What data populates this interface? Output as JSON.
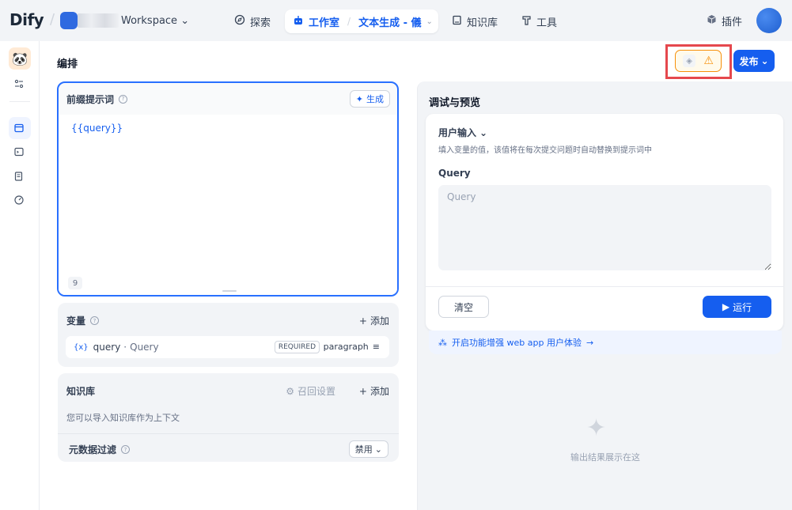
{
  "nav": {
    "logo": "Dify",
    "workspace_label": "Workspace",
    "explore": "探索",
    "studio": "工作室",
    "app_name": "文本生成 - 儀",
    "knowledge": "知识库",
    "tools": "工具",
    "plugins": "插件"
  },
  "header": {
    "title": "编排",
    "publish_label": "发布"
  },
  "prompt": {
    "title": "前缀提示词",
    "generate_label": "生成",
    "content": "{{query}}",
    "char_count": "9"
  },
  "variables": {
    "title": "变量",
    "add_label": "添加",
    "items": [
      {
        "icon": "{x}",
        "name": "query",
        "label": "Query",
        "required": "REQUIRED",
        "type": "paragraph"
      }
    ]
  },
  "knowledge": {
    "title": "知识库",
    "recall_label": "召回设置",
    "add_label": "添加",
    "description": "您可以导入知识库作为上下文",
    "metadata_filter": "元数据过滤",
    "filter_value": "禁用"
  },
  "debug": {
    "title": "调试与预览",
    "user_input_title": "用户输入",
    "user_input_desc": "填入变量的值，该值将在每次提交问题时自动替换到提示词中",
    "query_label": "Query",
    "query_placeholder": "Query",
    "query_value": "",
    "clear_label": "清空",
    "run_label": "运行",
    "feature_label": "开启功能增强 web app 用户体验",
    "empty_text": "输出结果展示在这"
  },
  "colors": {
    "accent": "#155eef",
    "warning": "#f79009",
    "highlight": "#e5484d"
  }
}
